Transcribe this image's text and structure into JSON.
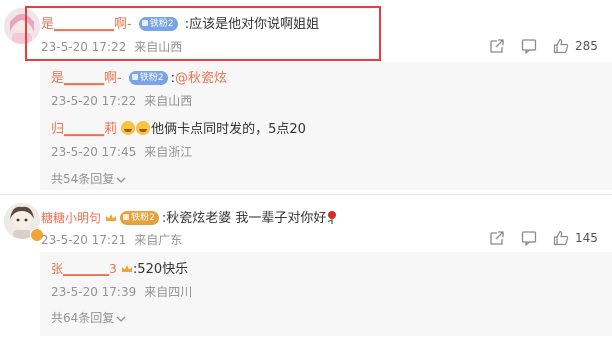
{
  "comments": [
    {
      "username": "是▁▁▁▁▁▁啊-",
      "badge": "铁粉2",
      "text": ":应该是他对你说啊姐姐",
      "meta": {
        "date": "23-5-20 17:22",
        "location": "来自山西"
      },
      "likes": "285",
      "replies": [
        {
          "username": "是▁▁▁▁啊-",
          "badge": "铁粉2",
          "text_prefix": ":",
          "mention": "@秋瓷炫",
          "meta": {
            "date": "23-5-20 17:22",
            "location": "来自山西"
          }
        },
        {
          "username": "归▁▁▁▁莉",
          "text": "他俩卡点同时发的，5点20",
          "meta": {
            "date": "23-5-20 17:45",
            "location": "来自浙江"
          }
        }
      ],
      "expand": "共54条回复"
    },
    {
      "username": "糖糖小明句",
      "badge": "铁粉2",
      "text": ":秋瓷炫老婆  我一辈子对你好",
      "meta": {
        "date": "23-5-20 17:21",
        "location": "来自广东"
      },
      "likes": "145",
      "replies": [
        {
          "username": "张▁▁▁▁▁3",
          "text": ":520快乐",
          "meta": {
            "date": "23-5-20 17:39",
            "location": "来自四川"
          }
        }
      ],
      "expand": "共64条回复"
    }
  ],
  "colors": {
    "username": "#eb7350",
    "meta": "#939393",
    "highlight": "#e53f3f",
    "badge": "#7aa4e6"
  },
  "icons": [
    "share-icon",
    "comment-icon",
    "thumbs-up-icon",
    "crown-icon",
    "emoji-icon",
    "rose-icon"
  ]
}
